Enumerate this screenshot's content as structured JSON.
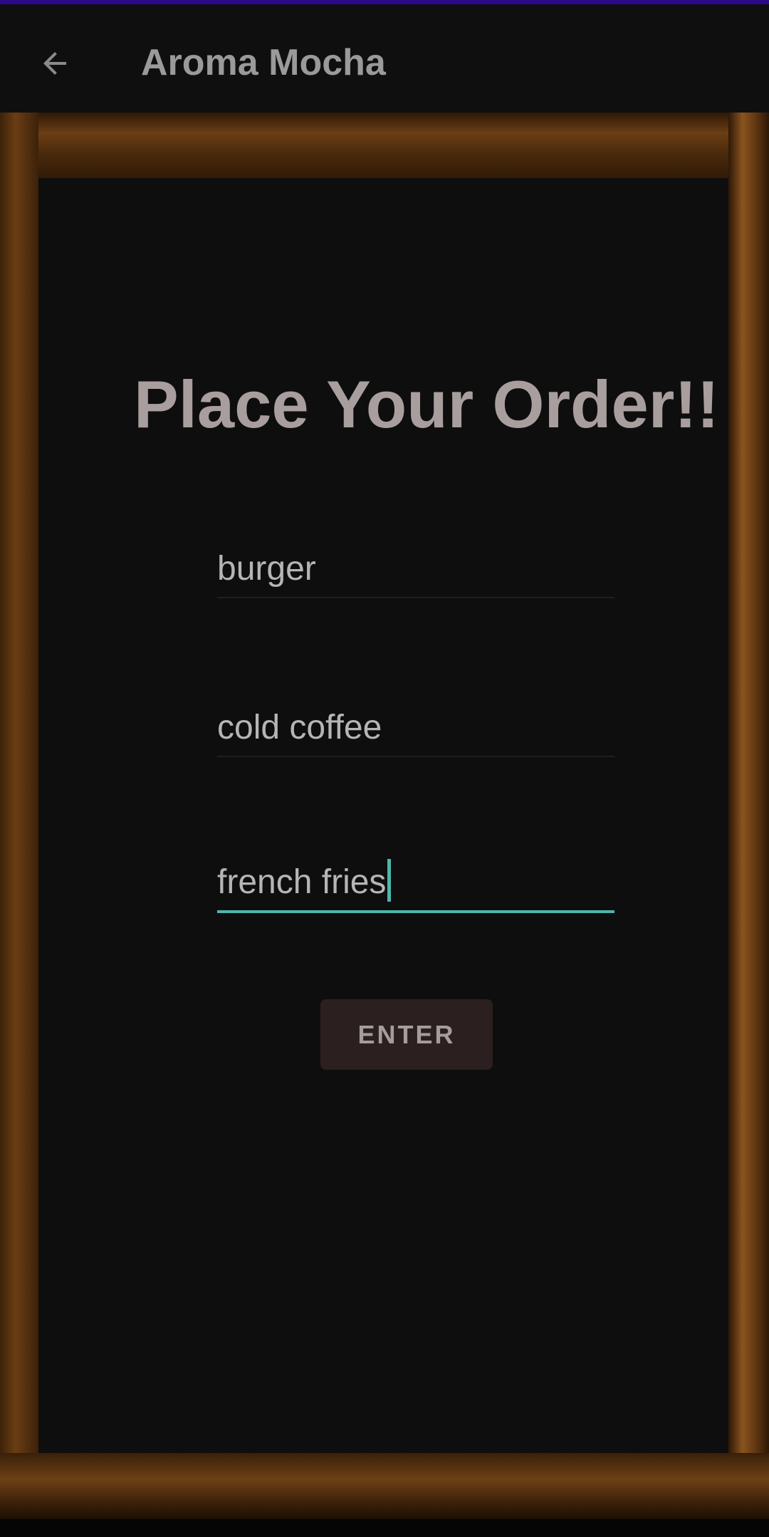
{
  "app_bar": {
    "title": "Aroma Mocha",
    "back_icon": "arrow-left-icon"
  },
  "main": {
    "heading": "Place Your Order!!",
    "fields": [
      {
        "value": "burger",
        "focused": false
      },
      {
        "value": "cold coffee",
        "focused": false
      },
      {
        "value": "french fries",
        "focused": true
      }
    ],
    "enter_label": "ENTER"
  },
  "colors": {
    "accent": "#4db6ac",
    "status_bar": "#2a0a8a",
    "board": "#0e0e0e",
    "heading": "#a99e9e",
    "button_bg": "#2c1f1f"
  }
}
